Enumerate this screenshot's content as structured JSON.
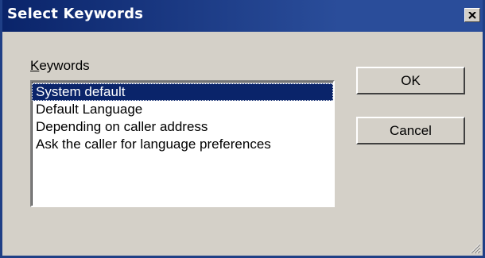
{
  "window": {
    "title": "Select Keywords",
    "close_icon": "close-icon"
  },
  "keywords": {
    "label_underlined": "K",
    "label_rest": "eywords",
    "items": [
      "System default",
      "Default Language",
      "Depending on caller address",
      "Ask the caller for language preferences"
    ],
    "selected_index": 0
  },
  "buttons": {
    "ok_label": "OK",
    "cancel_label": "Cancel"
  },
  "colors": {
    "title_bar": "#0a246a",
    "selection": "#0a246a",
    "face": "#d4d0c8"
  }
}
